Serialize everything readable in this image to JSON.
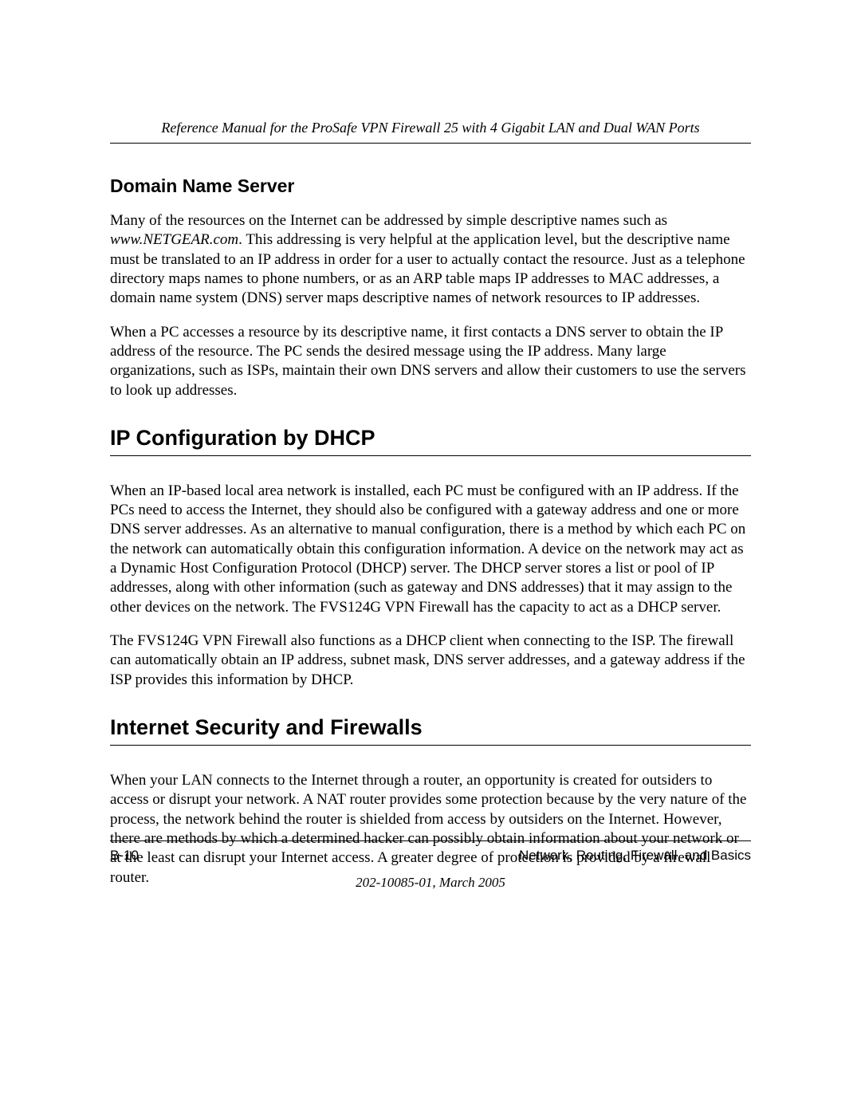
{
  "header": {
    "title": "Reference Manual for the ProSafe VPN Firewall 25 with 4 Gigabit LAN and Dual WAN Ports"
  },
  "sections": {
    "dns": {
      "heading": "Domain Name Server",
      "p1_a": "Many of the resources on the Internet can be addressed by simple descriptive names such as ",
      "p1_em": "www.NETGEAR.com",
      "p1_b": ". This addressing is very helpful at the application level, but the descriptive name must be translated to an IP address in order for a user to actually contact the resource. Just as a telephone directory maps names to phone numbers, or as an ARP table maps IP addresses to MAC addresses, a domain name system (DNS) server maps descriptive names of network resources to IP addresses.",
      "p2": "When a PC accesses a resource by its descriptive name, it first contacts a DNS server to obtain the IP address of the resource. The PC sends the desired message using the IP address. Many large organizations, such as ISPs, maintain their own DNS servers and allow their customers to use the servers to look up addresses."
    },
    "dhcp": {
      "heading": "IP Configuration by DHCP",
      "p1": "When an IP-based local area network is installed, each PC must be configured with an IP address. If the PCs need to access the Internet, they should also be configured with a gateway address and one or more DNS server addresses. As an alternative to manual configuration, there is a method by which each PC on the network can automatically obtain this configuration information. A device on the network may act as a Dynamic Host Configuration Protocol (DHCP) server. The DHCP server stores a list or pool of IP addresses, along with other information (such as gateway and DNS addresses) that it may assign to the other devices on the network. The FVS124G VPN Firewall has the capacity to act as a DHCP server.",
      "p2": "The FVS124G VPN Firewall also functions as a DHCP client when connecting to the ISP. The firewall can automatically obtain an IP address, subnet mask, DNS server addresses, and a gateway address if the ISP provides this information by DHCP."
    },
    "firewall": {
      "heading": "Internet Security and Firewalls",
      "p1": "When your LAN connects to the Internet through a router, an opportunity is created for outsiders to access or disrupt your network. A NAT router provides some protection because by the very nature of the process, the network behind the router is shielded from access by outsiders on the Internet. However, there are methods by which a determined hacker can possibly obtain information about your network or at the least can disrupt your Internet access. A greater degree of protection is provided by a firewall router."
    }
  },
  "footer": {
    "page_number": "B-10",
    "section_title": "Network, Routing, Firewall, and Basics",
    "doc_date": "202-10085-01, March 2005"
  }
}
